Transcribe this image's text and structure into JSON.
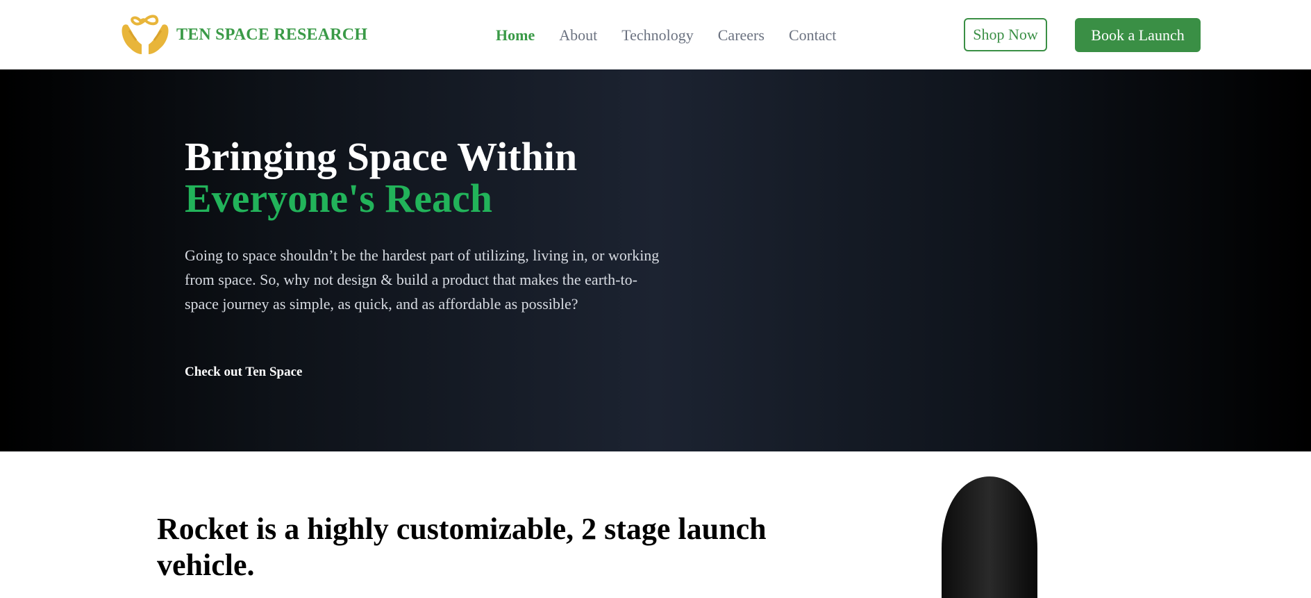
{
  "header": {
    "brand_name": "TEN SPACE RESEARCH",
    "logo_icon": "hands-infinity-logo",
    "nav": [
      {
        "label": "Home",
        "active": true
      },
      {
        "label": "About",
        "active": false
      },
      {
        "label": "Technology",
        "active": false
      },
      {
        "label": "Careers",
        "active": false
      },
      {
        "label": "Contact",
        "active": false
      }
    ],
    "shop_label": "Shop Now",
    "book_label": "Book a Launch"
  },
  "hero": {
    "title_line1": "Bringing Space Within",
    "title_line2": "Everyone's Reach",
    "description": "Going to space shouldn’t be the hardest part of utilizing, living in, or working from space. So, why not design & build a product that makes the earth-to-space journey as simple, as quick, and as affordable as possible?",
    "cta_label": "Check out Ten Space"
  },
  "section": {
    "title": "Rocket is a highly customizable, 2 stage launch vehicle."
  },
  "colors": {
    "brand_green": "#3a9a47",
    "accent_green": "#22b35a",
    "logo_gold": "#e8b53a",
    "hero_bg": "#1c2331"
  }
}
